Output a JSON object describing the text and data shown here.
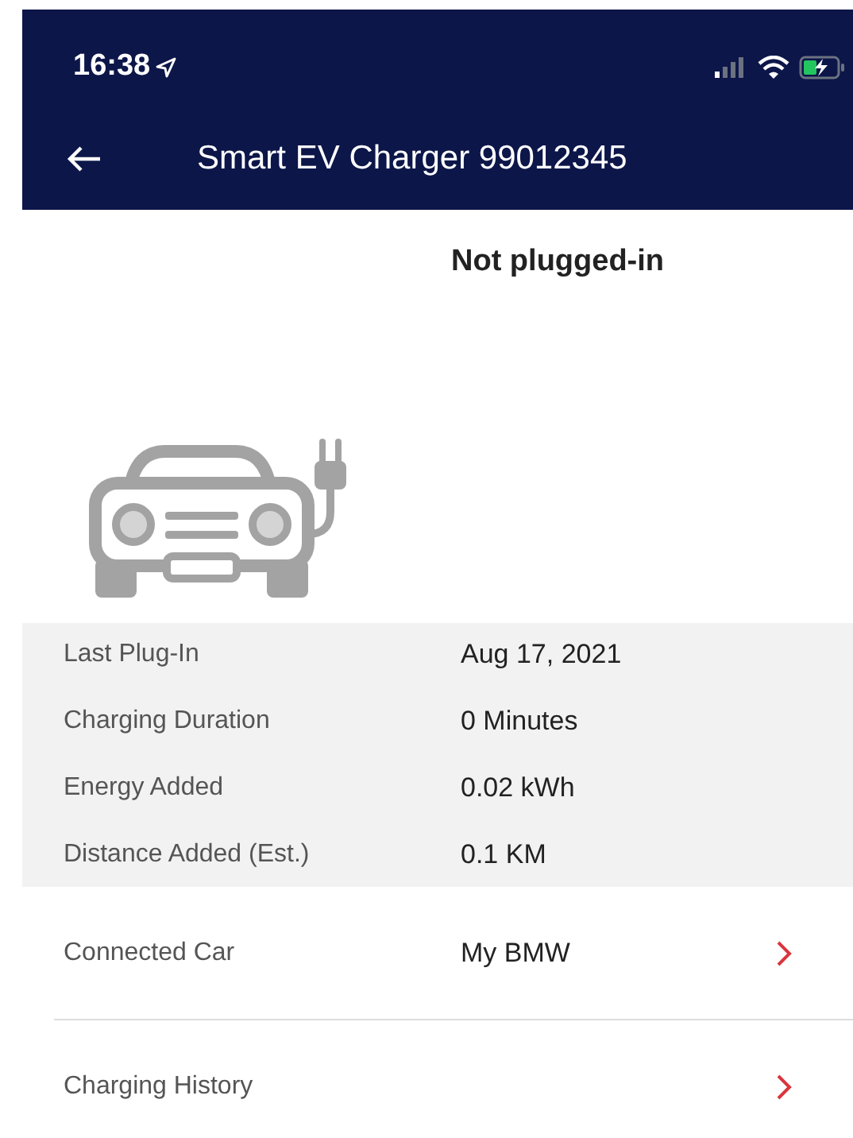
{
  "status_bar": {
    "time": "16:38"
  },
  "header": {
    "title": "Smart EV Charger 99012345"
  },
  "status": "Not plugged-in",
  "details": [
    {
      "label": "Last Plug-In",
      "value": "Aug 17, 2021"
    },
    {
      "label": "Charging Duration",
      "value": "0 Minutes"
    },
    {
      "label": "Energy Added",
      "value": "0.02 kWh"
    },
    {
      "label": "Distance Added (Est.)",
      "value": "0.1 KM"
    }
  ],
  "links": [
    {
      "label": "Connected Car",
      "value": "My BMW"
    },
    {
      "label": "Charging History"
    }
  ]
}
